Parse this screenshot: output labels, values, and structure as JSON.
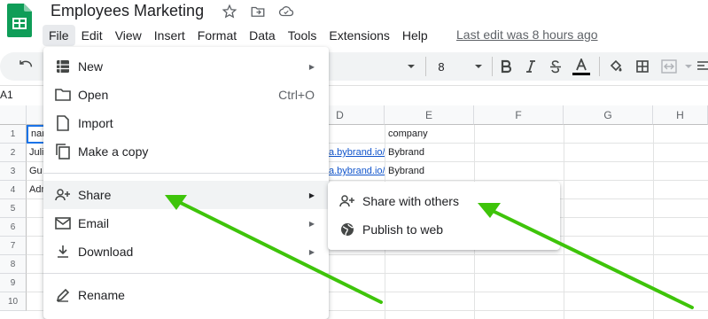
{
  "app": {
    "title": "Employees Marketing",
    "last_edit": "Last edit was 8 hours ago",
    "brand_color": "#0f9d58"
  },
  "menubar": [
    "File",
    "Edit",
    "View",
    "Insert",
    "Format",
    "Data",
    "Tools",
    "Extensions",
    "Help"
  ],
  "toolbar": {
    "font_size": "8"
  },
  "namebox": "A1",
  "columns": [
    "D",
    "E",
    "F",
    "G",
    "H"
  ],
  "rows": [
    "1",
    "2",
    "3",
    "4",
    "5",
    "6",
    "7",
    "8",
    "9",
    "10"
  ],
  "cells": {
    "a1": "nar",
    "a2": "Juli",
    "a3": "Gu",
    "a4": "Adr",
    "d2": "a.bybrand.io/c",
    "d3": "a.bybrand.io/i",
    "e1": "company",
    "e2": "Bybrand",
    "e3": "Bybrand"
  },
  "file_menu": {
    "new": "New",
    "open": "Open",
    "open_shortcut": "Ctrl+O",
    "import": "Import",
    "make_copy": "Make a copy",
    "share": "Share",
    "email": "Email",
    "download": "Download",
    "rename": "Rename"
  },
  "share_submenu": {
    "share_with_others": "Share with others",
    "publish_to_web": "Publish to web"
  },
  "annotation_color": "#3ec40a"
}
